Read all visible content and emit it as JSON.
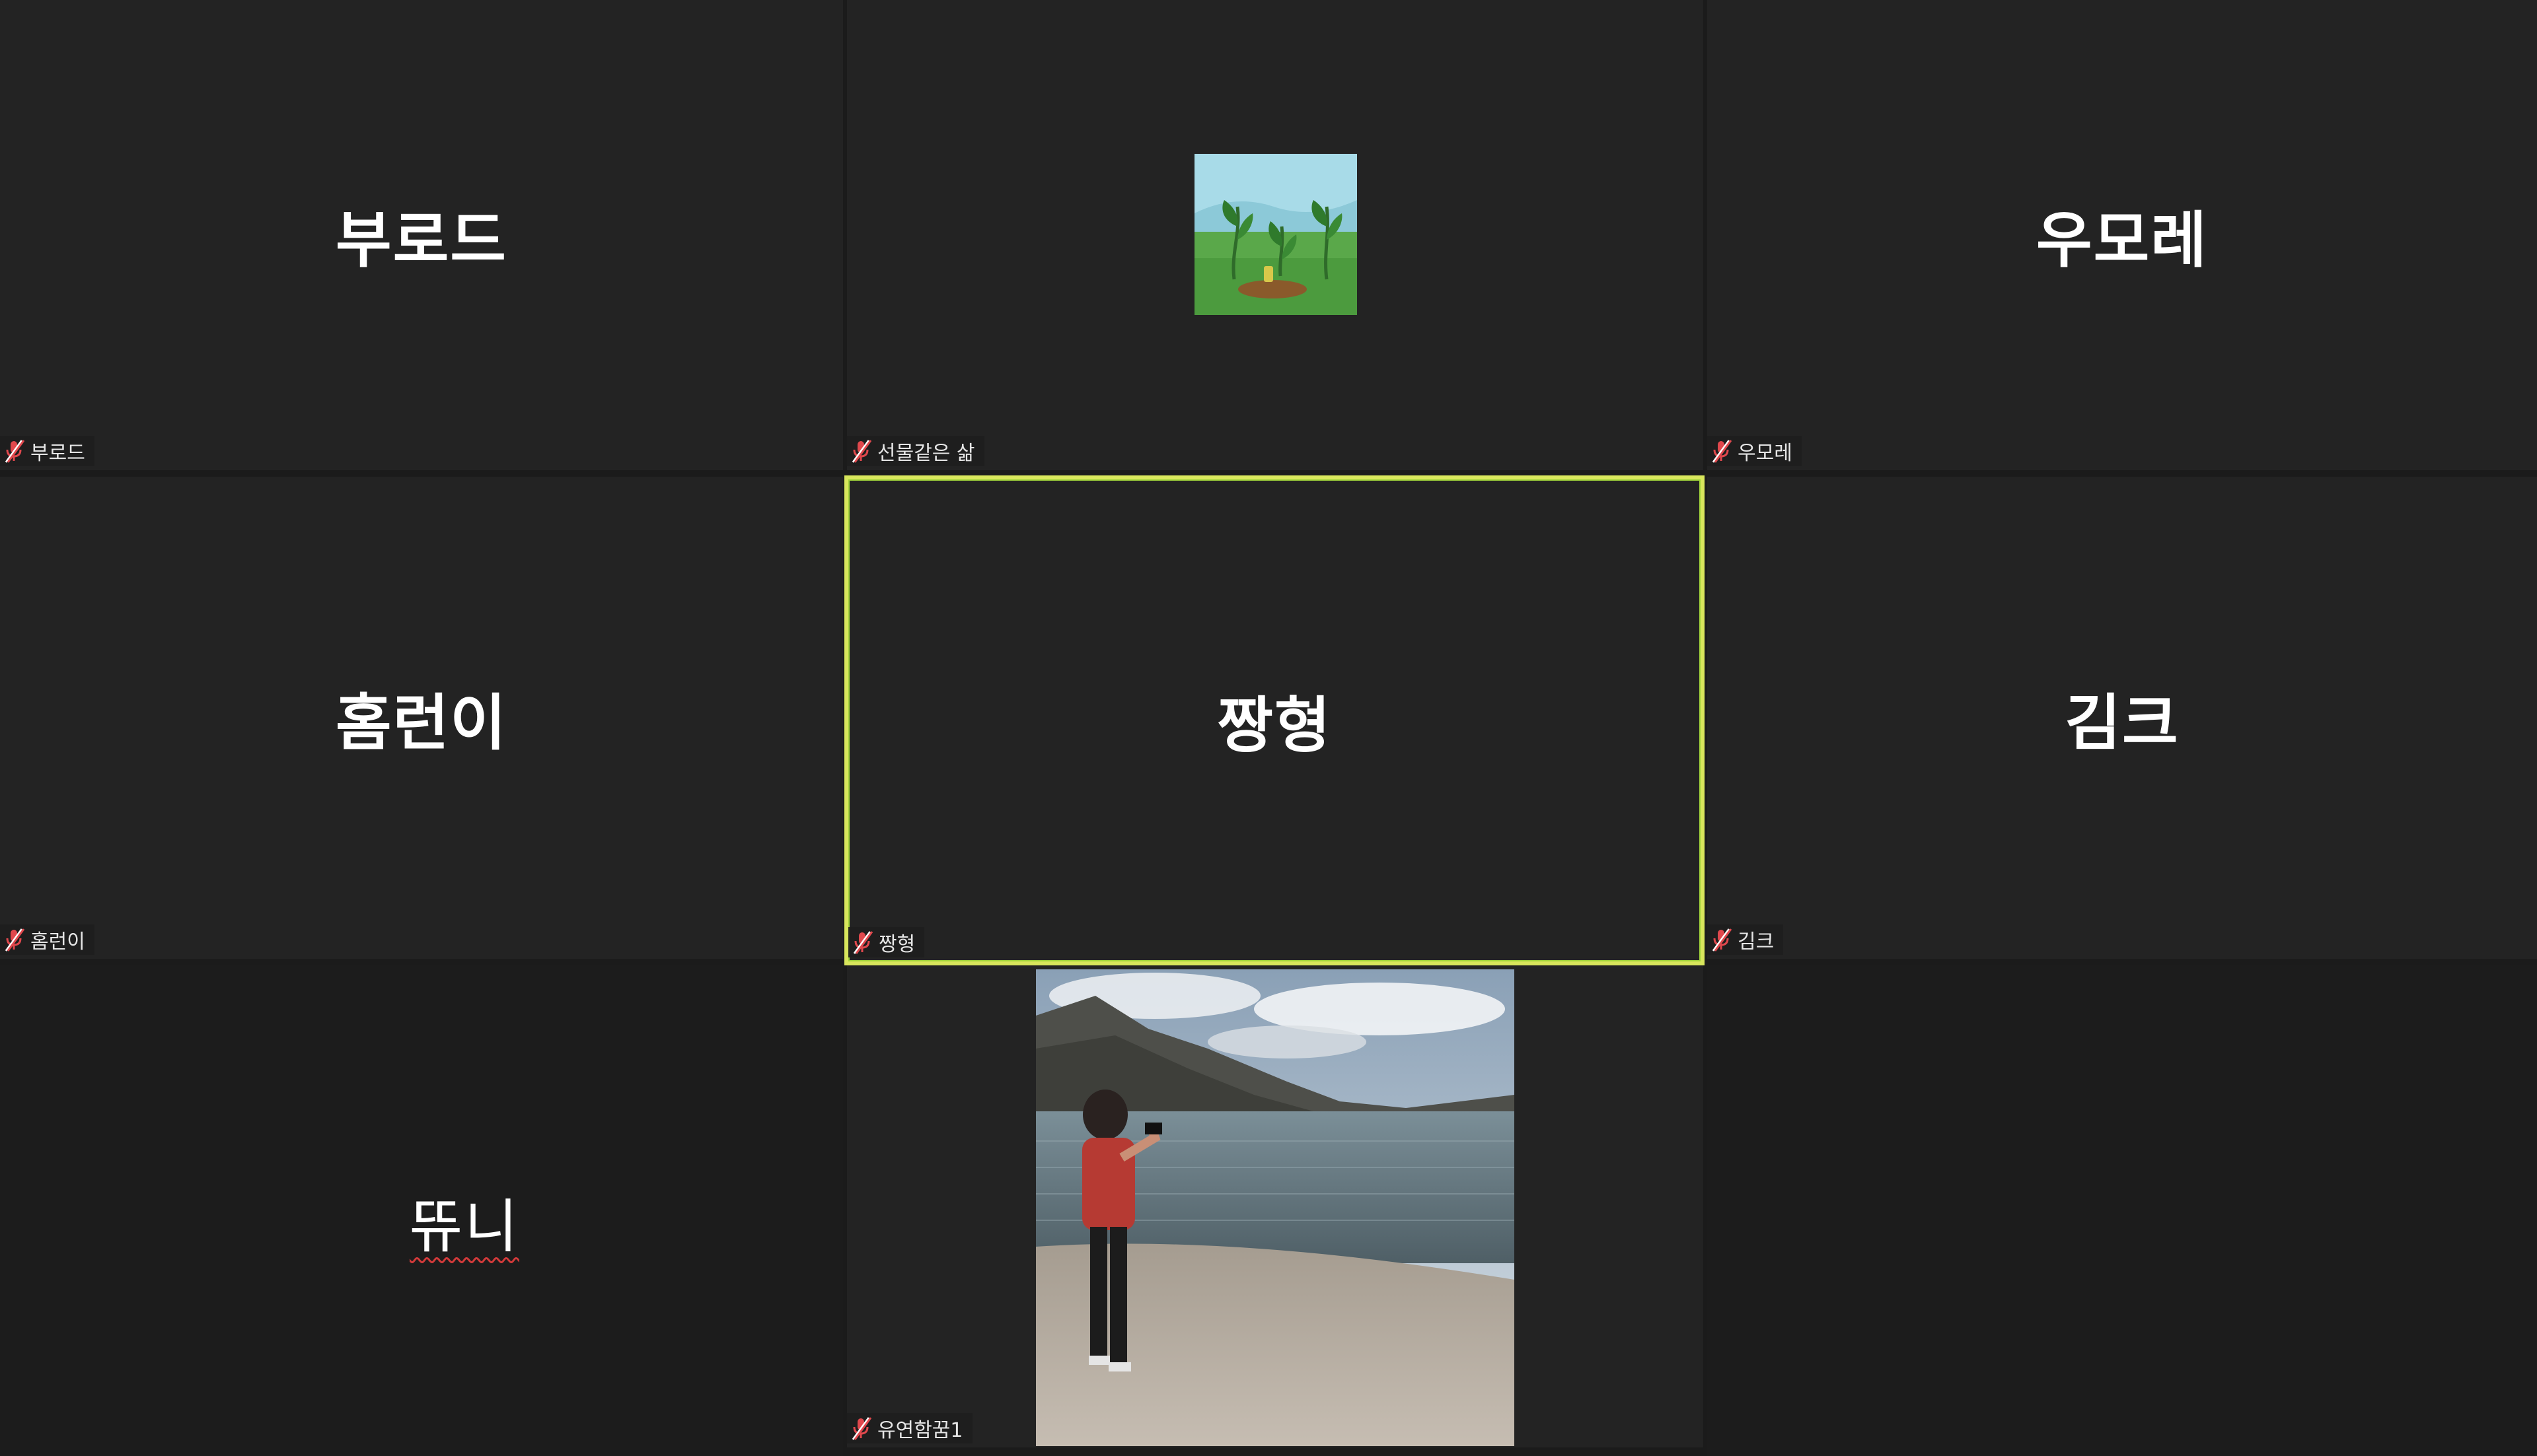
{
  "participants": [
    {
      "display_name": "부로드",
      "label": "부로드",
      "muted": true
    },
    {
      "display_name": "",
      "label": "선물같은 삶",
      "muted": true,
      "has_picture": true
    },
    {
      "display_name": "우모레",
      "label": "우모레",
      "muted": true
    },
    {
      "display_name": "홈런이",
      "label": "홈런이",
      "muted": true
    },
    {
      "display_name": "짱형",
      "label": "짱형",
      "muted": true,
      "active_speaker": true
    },
    {
      "display_name": "김크",
      "label": "김크",
      "muted": true
    },
    {
      "display_name": "뜌니",
      "label": "",
      "muted": false
    },
    {
      "display_name": "",
      "label": "유연함꿈1",
      "muted": true,
      "has_picture": true
    }
  ],
  "colors": {
    "background": "#1b1b1b",
    "tile": "#232323",
    "active_border": "#d8e65c",
    "muted_icon": "#e0484d"
  },
  "icons": {
    "muted_mic": "mic-muted-icon"
  }
}
